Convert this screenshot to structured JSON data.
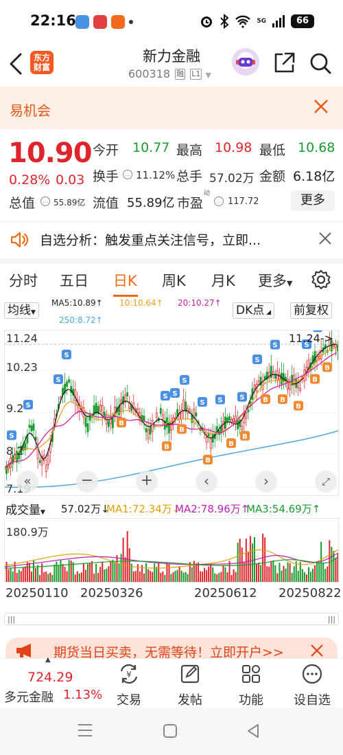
{
  "status_bar": {
    "time": "22:16",
    "battery": "66",
    "signal": "5G"
  },
  "header": {
    "logo_line1": "东方",
    "logo_line2": "财富",
    "stock_name": "新力金融",
    "stock_code": "600318",
    "tag_margin": "融",
    "tag_level": "L1"
  },
  "banner": {
    "text": "易机会"
  },
  "quote": {
    "price": "10.90",
    "change_pct": "0.28%",
    "change": "0.03",
    "open_label": "今开",
    "open": "10.77",
    "high_label": "最高",
    "high": "10.98",
    "low_label": "最低",
    "low": "10.68",
    "turnover_label": "换手",
    "turnover": "11.12%",
    "volume_label": "总手",
    "volume": "57.02万",
    "amount_label": "金额",
    "amount": "6.18亿",
    "mktcap_label": "总值",
    "mktcap": "55.89亿",
    "float_label": "流值",
    "float": "55.89亿",
    "pe_label": "市盈",
    "pe_sup": "动",
    "pe": "117.72",
    "more_label": "更多"
  },
  "notice": {
    "text": "自选分析：触发重点关注信号，立即..."
  },
  "tabs": [
    "分时",
    "五日",
    "日K",
    "周K",
    "月K",
    "更多"
  ],
  "ma_row": {
    "ma_toggle": "均线",
    "ma5": "MA5:10.89↑",
    "ma10": "10:10.64↑",
    "ma20": "20:10.27↑",
    "ma250": "250:8.72↑",
    "dk_label": "DK点",
    "adjust_label": "前复权"
  },
  "kline": {
    "y_top": "11.24",
    "y_mid": "10.23",
    "y_low": "9.2",
    "y_low2": "8.2",
    "y_bottom": "7.19",
    "last_label": "11.24->"
  },
  "volume": {
    "label": "成交量",
    "value": "57.02万↓",
    "ma1": "MA1:72.34万↓",
    "ma2": "MA2:78.96万↑",
    "ma3": "MA3:54.69万↑",
    "y_top": "180.9万"
  },
  "dates": [
    "20250110",
    "20250326",
    "20250612",
    "20250822"
  ],
  "ad": {
    "text": "期货当日买卖，无需等待！立即开户>>"
  },
  "bottom_bar": {
    "index_value": "724.29",
    "index_name": "多元金融",
    "index_pct": "1.13%",
    "items": [
      "交易",
      "发帖",
      "功能",
      "设自选"
    ]
  },
  "colors": {
    "up": "#e0242b",
    "down": "#1a9b2e",
    "accent": "#ef6b12",
    "ma5": "#222222",
    "ma10": "#f0a020",
    "ma20": "#d020a0",
    "ma250": "#4aa8e0"
  }
}
